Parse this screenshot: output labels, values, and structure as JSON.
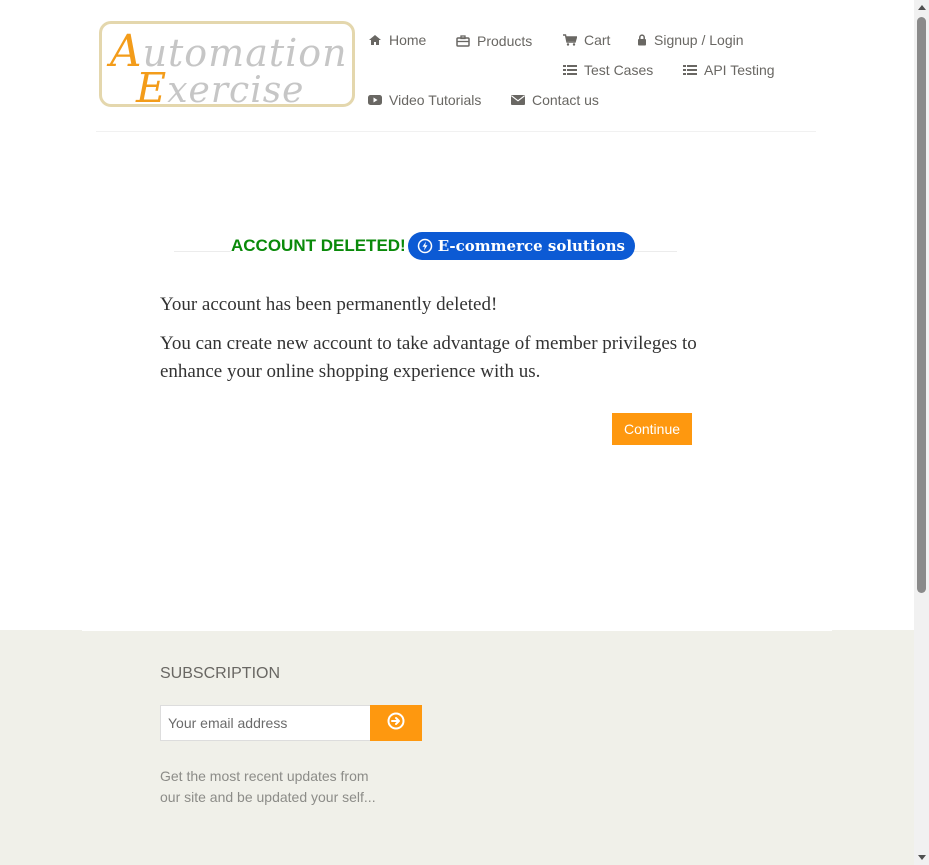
{
  "header": {
    "logo": {
      "line1": "Automation",
      "line2": "Exercise"
    },
    "nav": {
      "home": "Home",
      "products": "Products",
      "cart": "Cart",
      "signup_login": "Signup / Login",
      "test_cases": "Test Cases",
      "api_testing": "API Testing",
      "video_tutorials": "Video Tutorials",
      "contact_us": "Contact us"
    }
  },
  "main": {
    "title": "ACCOUNT DELETED!",
    "badge": "E-commerce solutions",
    "message1": "Your account has been permanently deleted!",
    "message2": "You can create new account to take advantage of member privileges to enhance your online shopping experience with us.",
    "continue_label": "Continue"
  },
  "footer": {
    "subscription_title": "SUBSCRIPTION",
    "email_placeholder": "Your email address",
    "description": "Get the most recent updates from our site and be updated your self..."
  },
  "colors": {
    "accent": "#fe980f",
    "title_green": "#0a8a0a",
    "badge_blue": "#0c5ad4",
    "footer_bg": "#f0f0e9"
  }
}
